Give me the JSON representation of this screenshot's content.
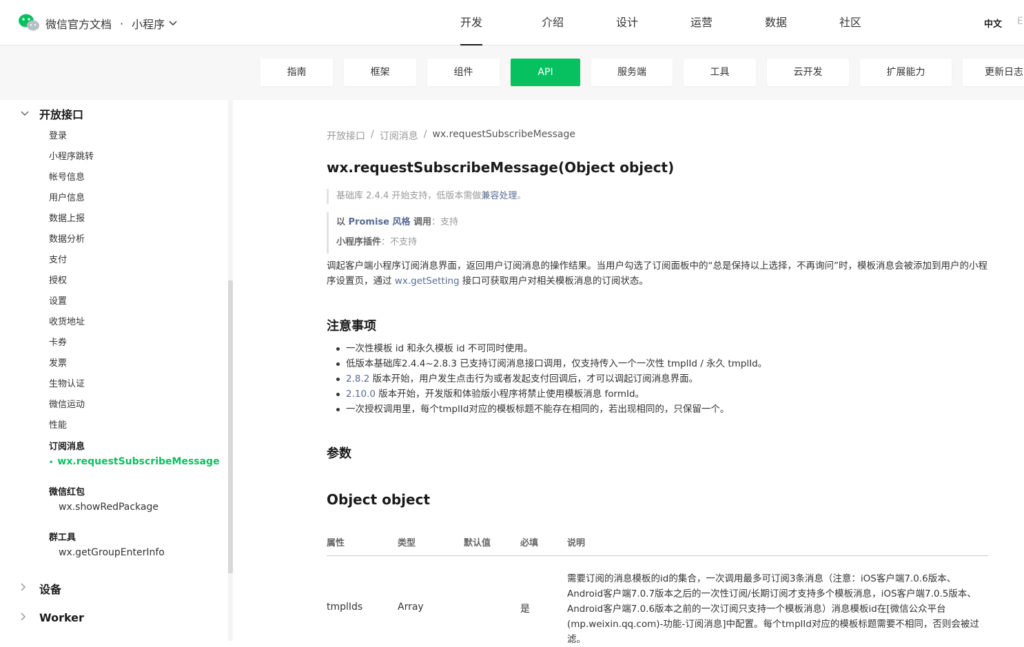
{
  "header": {
    "brand": "微信官方文档",
    "separator": "·",
    "product": "小程序",
    "nav": [
      "开发",
      "介绍",
      "设计",
      "运营",
      "数据",
      "社区"
    ],
    "active_nav": "开发",
    "lang": "中文",
    "lang_next": "E"
  },
  "subtabs": [
    "指南",
    "框架",
    "组件",
    "API",
    "服务端",
    "工具",
    "云开发",
    "扩展能力",
    "更新日志"
  ],
  "active_subtab": "API",
  "sidebar": {
    "section_open": "开放接口",
    "items": [
      "登录",
      "小程序跳转",
      "帐号信息",
      "用户信息",
      "数据上报",
      "数据分析",
      "支付",
      "授权",
      "设置",
      "收货地址",
      "卡券",
      "发票",
      "生物认证",
      "微信运动",
      "性能"
    ],
    "group_subscribe": "订阅消息",
    "active_item": "wx.requestSubscribeMessage",
    "group_redpackage": "微信红包",
    "redpackage_item": "wx.showRedPackage",
    "group_tools": "群工具",
    "tools_item": "wx.getGroupEnterInfo",
    "section_device": "设备",
    "section_worker": "Worker"
  },
  "main": {
    "breadcrumb": [
      "开放接口",
      "/",
      "订阅消息",
      "/",
      "wx.requestSubscribeMessage"
    ],
    "title": "wx.requestSubscribeMessage(Object object)",
    "support_text": "基础库 2.4.4 开始支持，低版本需做",
    "support_link": "兼容处理",
    "support_end": "。",
    "promise_prefix": "以 ",
    "promise_link": "Promise 风格",
    "promise_label": " 调用",
    "promise_value": "：支持",
    "plugin_label": "小程序插件",
    "plugin_value": "：不支持",
    "intro_1": "调起客户端小程序订阅消息界面，返回用户订阅消息的操作结果。当用户勾选了订阅面板中的“总是保持以上选择，不再询问”时，模板消息会被添加到用户的小程序设置页，通过 ",
    "intro_link": "wx.getSetting",
    "intro_2": " 接口可获取用户对相关模板消息的订阅状态。",
    "notes_heading": "注意事项",
    "notes": [
      {
        "link": "",
        "text": "一次性模板 id 和永久模板 id 不可同时使用。"
      },
      {
        "link": "",
        "text": "低版本基础库2.4.4~2.8.3 已支持订阅消息接口调用，仅支持传入一个一次性 tmplId / 永久 tmplId。"
      },
      {
        "link": "2.8.2",
        "text": " 版本开始，用户发生点击行为或者发起支付回调后，才可以调起订阅消息界面。"
      },
      {
        "link": "2.10.0",
        "text": " 版本开始，开发版和体验版小程序将禁止使用模板消息 formId。"
      },
      {
        "link": "",
        "text": "一次授权调用里，每个tmplId对应的模板标题不能存在相同的，若出现相同的，只保留一个。"
      }
    ],
    "params_heading": "参数",
    "object_heading": "Object object",
    "table": {
      "headers": [
        "属性",
        "类型",
        "默认值",
        "必填",
        "说明"
      ],
      "rows": [
        {
          "attr": "tmplIds",
          "type": "Array",
          "default": "",
          "required": "是",
          "desc": "需要订阅的消息模板的id的集合，一次调用最多可订阅3条消息（注意：iOS客户端7.0.6版本、Android客户端7.0.7版本之后的一次性订阅/长期订阅才支持多个模板消息，iOS客户端7.0.5版本、Android客户端7.0.6版本之前的一次订阅只支持一个模板消息）消息模板id在[微信公众平台(mp.weixin.qq.com)-功能-订阅消息]中配置。每个tmplId对应的模板标题需要不相同，否则会被过滤。"
        }
      ]
    }
  },
  "colors": {
    "accent": "#07c160",
    "link": "#576b95",
    "subbar_bg": "#f7f7f7"
  }
}
